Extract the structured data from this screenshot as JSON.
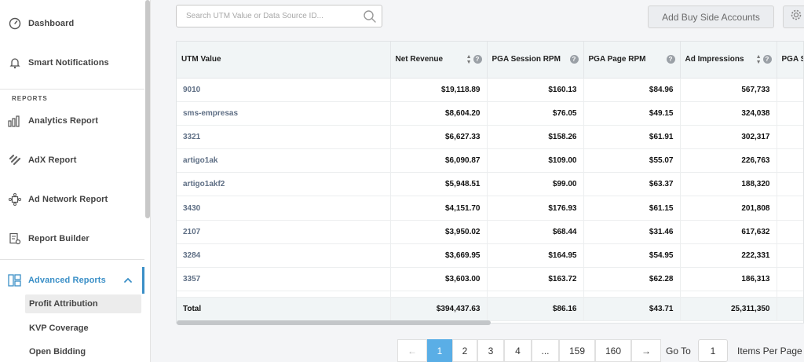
{
  "sidebar": {
    "items": [
      {
        "label": "Dashboard",
        "icon": "dashboard-gauge-icon"
      },
      {
        "label": "Smart Notifications",
        "icon": "bell-icon"
      }
    ],
    "section_label": "REPORTS",
    "reports": [
      {
        "label": "Analytics Report",
        "icon": "bar-chart-icon"
      },
      {
        "label": "AdX Report",
        "icon": "stacked-layers-icon"
      },
      {
        "label": "Ad Network Report",
        "icon": "network-icon"
      },
      {
        "label": "Report Builder",
        "icon": "report-gear-icon"
      },
      {
        "label": "Advanced Reports",
        "icon": "layout-grid-icon",
        "expanded": true
      }
    ],
    "sub_items": [
      {
        "label": "Profit Attribution",
        "selected": true
      },
      {
        "label": "KVP Coverage",
        "selected": false
      },
      {
        "label": "Open Bidding",
        "selected": false
      }
    ],
    "accent_color": "#3a8fc7"
  },
  "search": {
    "placeholder": "Search UTM Value or Data Source ID...",
    "value": ""
  },
  "toolbar": {
    "add_button_label": "Add Buy Side Accounts"
  },
  "table": {
    "columns": [
      "UTM Value",
      "Net Revenue",
      "PGA Session RPM",
      "PGA Page RPM",
      "Ad Impressions",
      "PGA Se"
    ],
    "rows": [
      [
        "9010",
        "$19,118.89",
        "$160.13",
        "$84.96",
        "567,733"
      ],
      [
        "sms-empresas",
        "$8,604.20",
        "$76.05",
        "$49.15",
        "324,038"
      ],
      [
        "3321",
        "$6,627.33",
        "$158.26",
        "$61.91",
        "302,317"
      ],
      [
        "artigo1ak",
        "$6,090.87",
        "$109.00",
        "$55.07",
        "226,763"
      ],
      [
        "artigo1akf2",
        "$5,948.51",
        "$99.00",
        "$63.37",
        "188,320"
      ],
      [
        "3430",
        "$4,151.70",
        "$176.93",
        "$61.15",
        "201,808"
      ],
      [
        "2107",
        "$3,950.02",
        "$68.44",
        "$31.46",
        "617,632"
      ],
      [
        "3284",
        "$3,669.95",
        "$164.95",
        "$54.95",
        "222,331"
      ],
      [
        "3357",
        "$3,603.00",
        "$163.72",
        "$62.28",
        "186,313"
      ]
    ],
    "total": [
      "Total",
      "$394,437.63",
      "$86.16",
      "$43.71",
      "25,311,350"
    ]
  },
  "pagination": {
    "prev": "←",
    "next": "→",
    "pages": [
      "1",
      "2",
      "3",
      "4",
      "...",
      "159",
      "160"
    ],
    "current": "1",
    "goto_label": "Go To",
    "goto_value": "1",
    "items_per_page_label": "Items Per Page",
    "active_color": "#5aaee6"
  }
}
